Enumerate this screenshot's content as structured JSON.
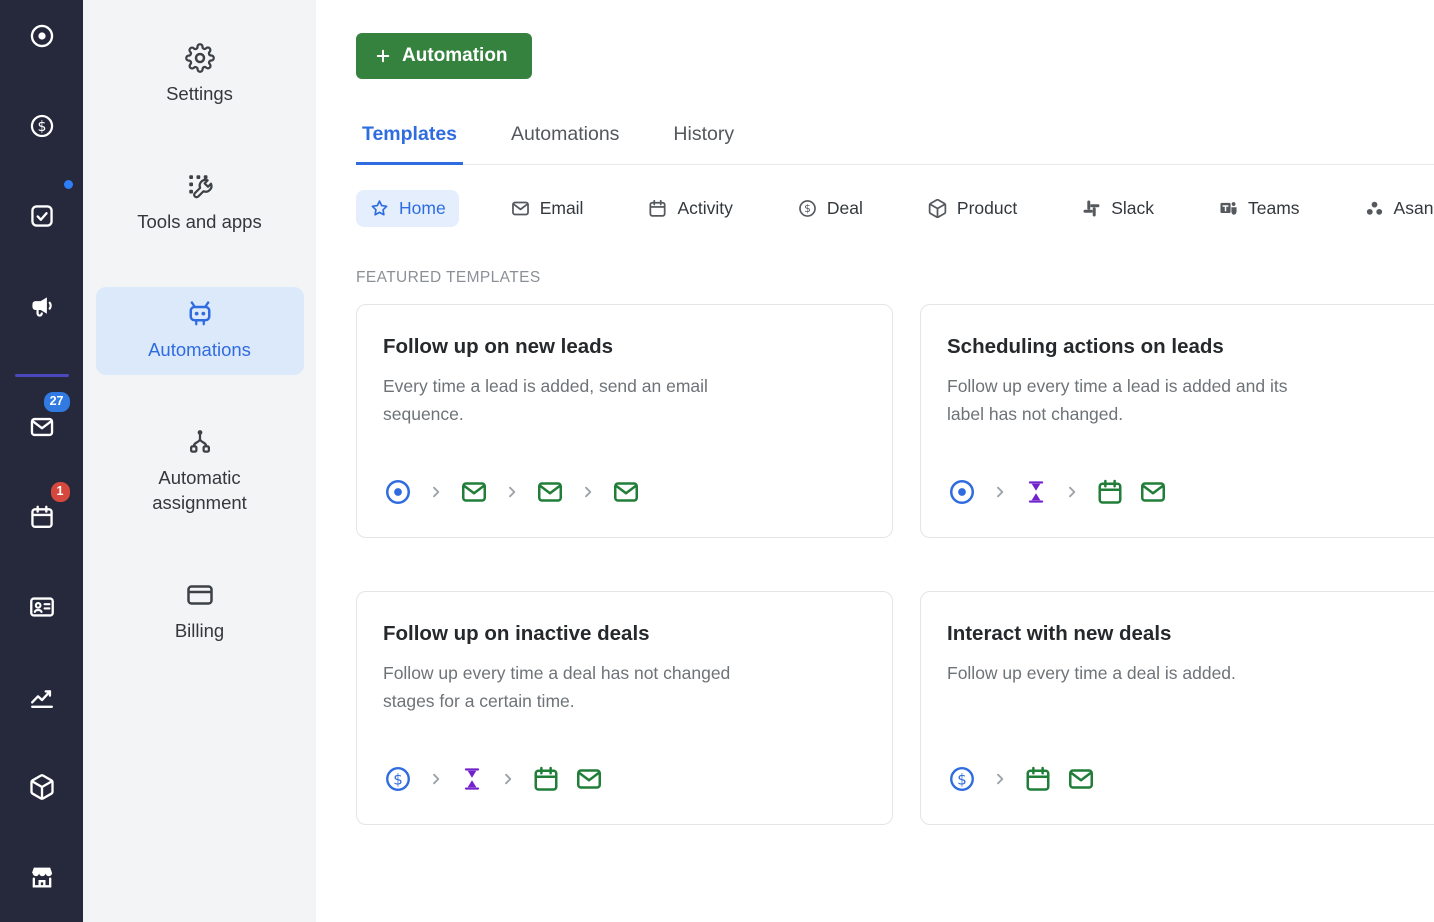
{
  "colors": {
    "rail_bg": "#26293c",
    "accent_blue": "#2f6ce0",
    "button_green": "#35823e",
    "flow_green": "#217e38",
    "flow_purple": "#7222cc",
    "badge_blue": "#317ae2",
    "badge_red": "#d6483e",
    "chip_active_bg": "#e4eefc",
    "sidebar_active_bg": "#dce9fb"
  },
  "rail": {
    "mail_badge": "27",
    "calendar_badge": "1",
    "icons": [
      "bullseye-icon",
      "dollar-icon",
      "checklist-icon",
      "megaphone-icon",
      "envelope-icon",
      "calendar-icon",
      "contact-card-icon",
      "line-chart-icon",
      "package-icon",
      "storefront-icon"
    ]
  },
  "sidebar": {
    "items": [
      {
        "label": "Settings",
        "icon": "gear-icon",
        "active": false
      },
      {
        "label": "Tools and apps",
        "icon": "tools-grid-icon",
        "active": false
      },
      {
        "label": "Automations",
        "icon": "robot-icon",
        "active": true
      },
      {
        "label": "Automatic assignment",
        "icon": "assignment-branch-icon",
        "active": false
      },
      {
        "label": "Billing",
        "icon": "credit-card-icon",
        "active": false
      }
    ]
  },
  "header": {
    "new_automation_button": "Automation"
  },
  "tabs": [
    {
      "label": "Templates",
      "active": true
    },
    {
      "label": "Automations",
      "active": false
    },
    {
      "label": "History",
      "active": false
    }
  ],
  "filters": [
    {
      "label": "Home",
      "icon": "star-icon",
      "active": true
    },
    {
      "label": "Email",
      "icon": "envelope-icon",
      "active": false
    },
    {
      "label": "Activity",
      "icon": "calendar-icon",
      "active": false
    },
    {
      "label": "Deal",
      "icon": "dollar-icon",
      "active": false
    },
    {
      "label": "Product",
      "icon": "package-icon",
      "active": false
    },
    {
      "label": "Slack",
      "icon": "slack-icon",
      "active": false
    },
    {
      "label": "Teams",
      "icon": "teams-icon",
      "active": false
    },
    {
      "label": "Asana",
      "icon": "asana-icon",
      "active": false
    }
  ],
  "templates_section": {
    "title": "FEATURED TEMPLATES",
    "cards": [
      {
        "title": "Follow up on new leads",
        "description": "Every time a lead is added, send an email sequence.",
        "flow": [
          "lead-target",
          "email",
          "email",
          "email"
        ]
      },
      {
        "title": "Scheduling actions on leads",
        "description": "Follow up every time a lead is added and its label has not changed.",
        "flow": [
          "lead-target",
          "wait-delay",
          "activity-calendar",
          "email"
        ]
      },
      {
        "title": "Follow up on inactive deals",
        "description": "Follow up every time a deal has not changed stages for a certain time.",
        "flow": [
          "deal-dollar",
          "wait-delay",
          "activity-calendar",
          "email"
        ]
      },
      {
        "title": "Interact with new deals",
        "description": "Follow up every time a deal is added.",
        "flow": [
          "deal-dollar",
          "activity-calendar",
          "email"
        ]
      }
    ]
  }
}
